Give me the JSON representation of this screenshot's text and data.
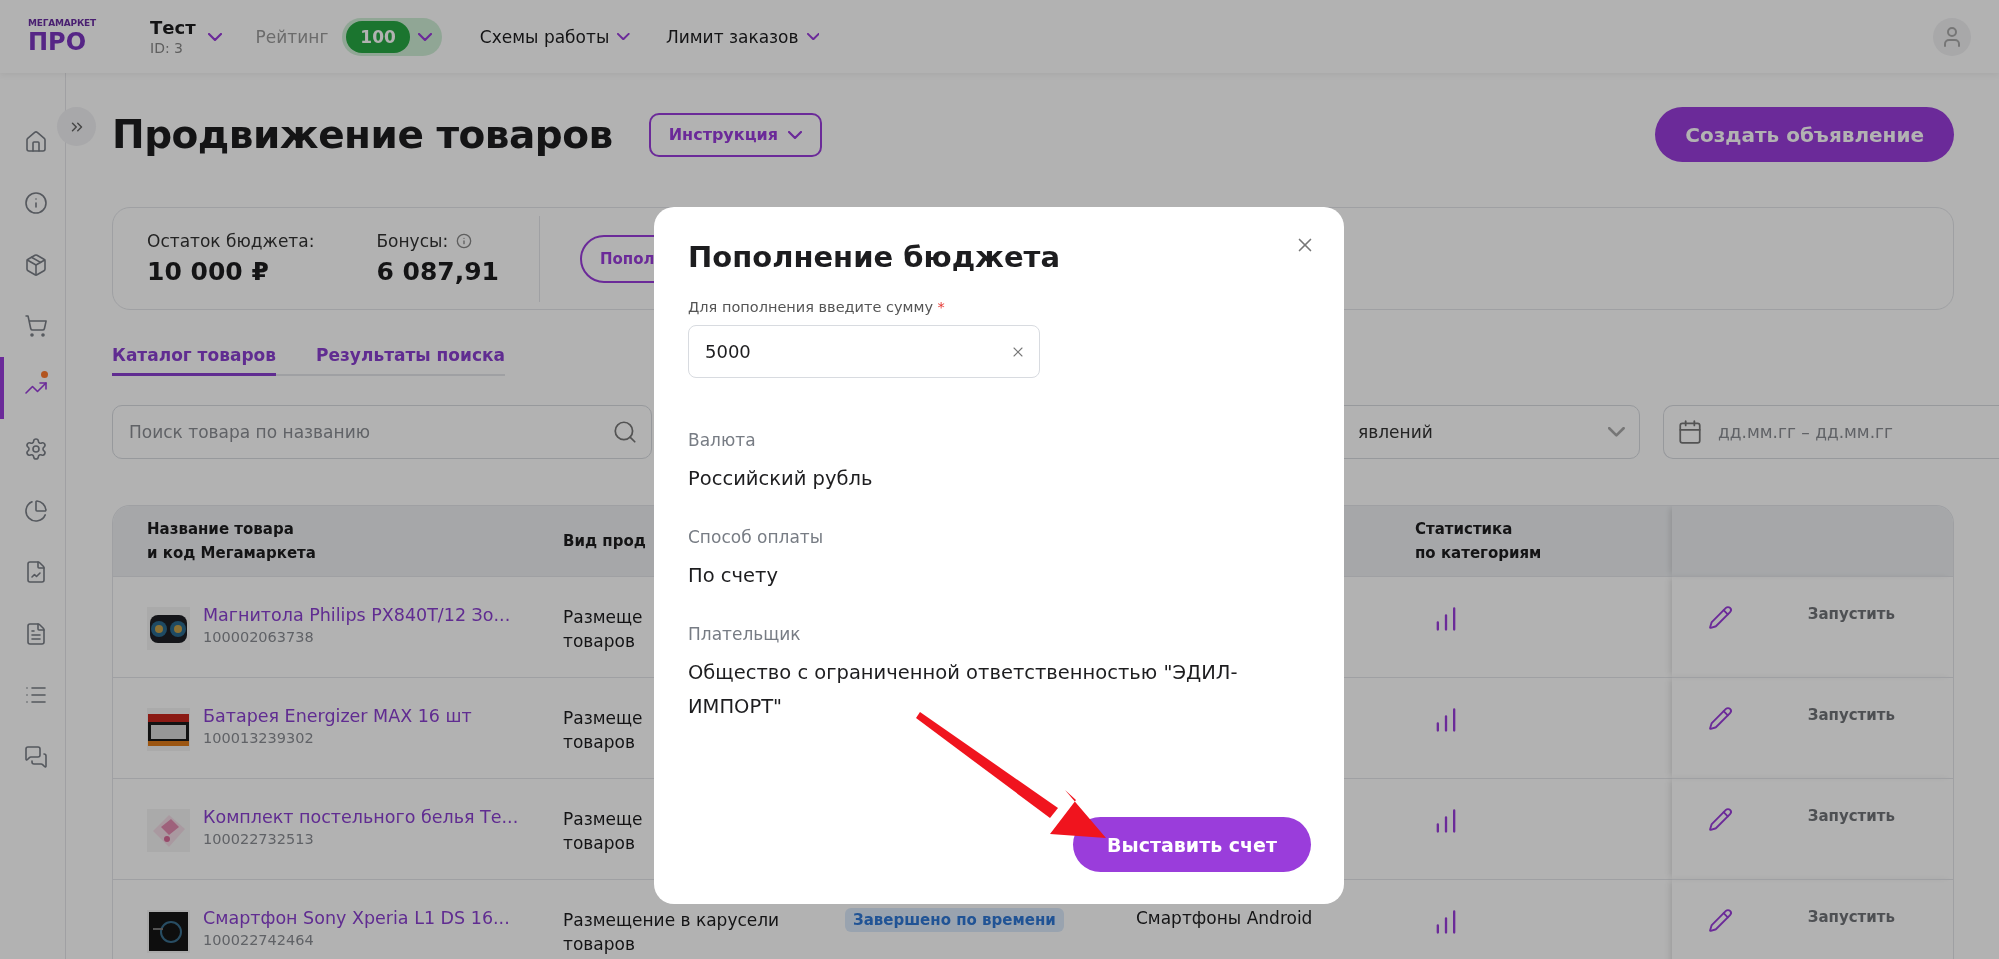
{
  "top_bar": {
    "logo_top": "МЕГАМАРКЕТ",
    "logo_main": "ПРО",
    "account": {
      "name": "Тест",
      "id": "ID: 3"
    },
    "rating": {
      "label": "Рейтинг",
      "value": "100"
    },
    "menus": [
      "Схемы работы",
      "Лимит заказов"
    ]
  },
  "sidebar": {
    "items": [
      {
        "kind": "home",
        "selected": false,
        "notification": false
      },
      {
        "kind": "info",
        "selected": false,
        "notification": false
      },
      {
        "kind": "box",
        "selected": false,
        "notification": false
      },
      {
        "kind": "cart",
        "selected": false,
        "notification": false
      },
      {
        "kind": "promo",
        "selected": true,
        "notification": true
      },
      {
        "kind": "settings",
        "selected": false,
        "notification": false
      },
      {
        "kind": "pie",
        "selected": false,
        "notification": false
      },
      {
        "kind": "report",
        "selected": false,
        "notification": false
      },
      {
        "kind": "document",
        "selected": false,
        "notification": false
      },
      {
        "kind": "list",
        "selected": false,
        "notification": false
      },
      {
        "kind": "chat",
        "selected": false,
        "notification": false
      }
    ]
  },
  "page": {
    "title": "Продвижение товаров",
    "instruction_button": "Инструкция",
    "create_button": "Создать объявление"
  },
  "budget": {
    "balance_label": "Остаток бюджета:",
    "balance": "10 000 ₽",
    "bonus_label": "Бонусы:",
    "bonus": "6 087,91",
    "top_up_button": "Попол"
  },
  "tabs": [
    {
      "label": "Каталог товаров",
      "selected": true
    },
    {
      "label": "Результаты поиска",
      "selected": false
    }
  ],
  "search": {
    "placeholder": "Поиск товара по названию"
  },
  "ad_filter": {
    "value": "явлений"
  },
  "date_range": {
    "placeholder": "дд.мм.гг – дд.мм.гг"
  },
  "table": {
    "columns": {
      "product": "Название товара\nи код Мегамаркета",
      "type": "Вид прод",
      "stats": "Статистика\nпо категориям"
    },
    "rows": [
      {
        "name": "Магнитола Philips PX840T/12 Зо...",
        "code": "100002063738",
        "type": [
          "Размеще",
          "товаров"
        ],
        "action": "Запустить"
      },
      {
        "name": "Батарея Energizer MAX 16 шт",
        "code": "100013239302",
        "type": [
          "Размеще",
          "товаров"
        ],
        "action": "Запустить"
      },
      {
        "name": "Комплект постельного белья Те...",
        "code": "100022732513",
        "type": [
          "Размеще",
          "товаров"
        ],
        "action": "Запустить"
      },
      {
        "name": "Смартфон Sony Xperia L1 DS 16...",
        "code": "100022742464",
        "type": [
          "Размещение в карусели",
          "товаров"
        ],
        "status": "Завершено по времени",
        "category": "Смартфоны Android",
        "action": "Запустить"
      }
    ]
  },
  "modal": {
    "title": "Пополнение бюджета",
    "amount": {
      "label": "Для пополнения введите сумму",
      "required_mark": "*",
      "value": "5000"
    },
    "details": [
      {
        "label": "Валюта",
        "value": "Российский рубль"
      },
      {
        "label": "Способ оплаты",
        "value": "По счету"
      },
      {
        "label": "Плательщик",
        "value": "Общество с ограниченной ответственностью \"ЭДИЛ-ИМПОРТ\""
      }
    ],
    "submit_button": "Выставить счет"
  }
}
